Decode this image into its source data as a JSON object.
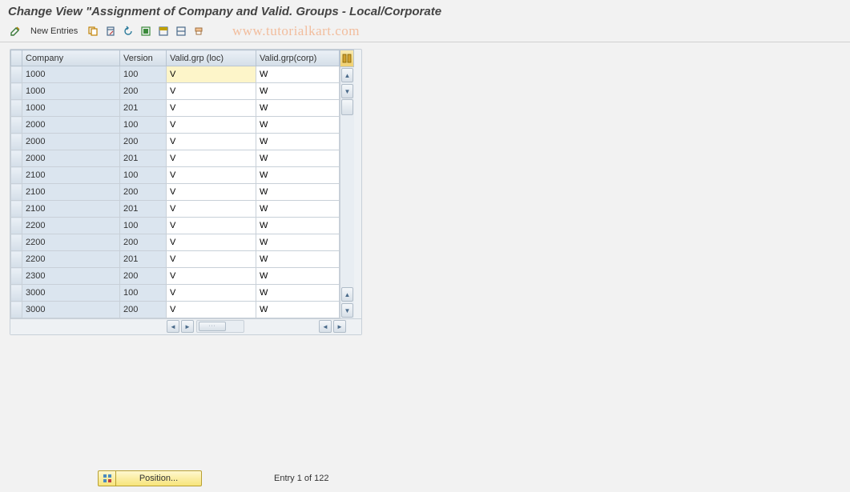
{
  "title": "Change View \"Assignment of Company and Valid. Groups - Local/Corporate",
  "watermark": "www.tutorialkart.com",
  "toolbar": {
    "new_entries_label": "New Entries"
  },
  "table": {
    "headers": {
      "company": "Company",
      "version": "Version",
      "valid_grp_loc": "Valid.grp (loc)",
      "valid_grp_corp": "Valid.grp(corp)"
    },
    "rows": [
      {
        "company": "1000",
        "version": "100",
        "loc": "V",
        "corp": "W"
      },
      {
        "company": "1000",
        "version": "200",
        "loc": "V",
        "corp": "W"
      },
      {
        "company": "1000",
        "version": "201",
        "loc": "V",
        "corp": "W"
      },
      {
        "company": "2000",
        "version": "100",
        "loc": "V",
        "corp": "W"
      },
      {
        "company": "2000",
        "version": "200",
        "loc": "V",
        "corp": "W"
      },
      {
        "company": "2000",
        "version": "201",
        "loc": "V",
        "corp": "W"
      },
      {
        "company": "2100",
        "version": "100",
        "loc": "V",
        "corp": "W"
      },
      {
        "company": "2100",
        "version": "200",
        "loc": "V",
        "corp": "W"
      },
      {
        "company": "2100",
        "version": "201",
        "loc": "V",
        "corp": "W"
      },
      {
        "company": "2200",
        "version": "100",
        "loc": "V",
        "corp": "W"
      },
      {
        "company": "2200",
        "version": "200",
        "loc": "V",
        "corp": "W"
      },
      {
        "company": "2200",
        "version": "201",
        "loc": "V",
        "corp": "W"
      },
      {
        "company": "2300",
        "version": "200",
        "loc": "V",
        "corp": "W"
      },
      {
        "company": "3000",
        "version": "100",
        "loc": "V",
        "corp": "W"
      },
      {
        "company": "3000",
        "version": "200",
        "loc": "V",
        "corp": "W"
      }
    ]
  },
  "footer": {
    "position_label": "Position...",
    "entry_text": "Entry 1 of 122"
  }
}
